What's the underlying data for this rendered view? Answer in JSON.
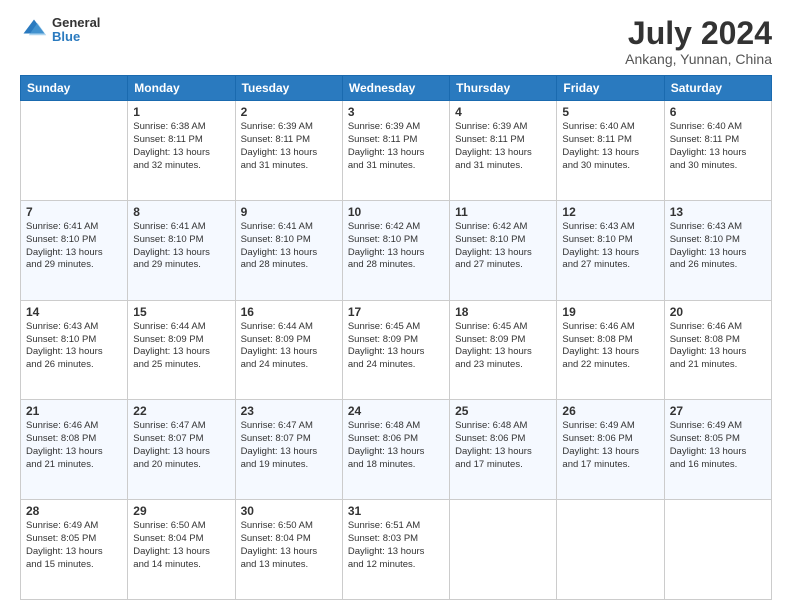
{
  "header": {
    "title": "July 2024",
    "subtitle": "Ankang, Yunnan, China",
    "logo_line1": "General",
    "logo_line2": "Blue"
  },
  "days_of_week": [
    "Sunday",
    "Monday",
    "Tuesday",
    "Wednesday",
    "Thursday",
    "Friday",
    "Saturday"
  ],
  "weeks": [
    [
      {
        "day": "",
        "info": ""
      },
      {
        "day": "1",
        "info": "Sunrise: 6:38 AM\nSunset: 8:11 PM\nDaylight: 13 hours\nand 32 minutes."
      },
      {
        "day": "2",
        "info": "Sunrise: 6:39 AM\nSunset: 8:11 PM\nDaylight: 13 hours\nand 31 minutes."
      },
      {
        "day": "3",
        "info": "Sunrise: 6:39 AM\nSunset: 8:11 PM\nDaylight: 13 hours\nand 31 minutes."
      },
      {
        "day": "4",
        "info": "Sunrise: 6:39 AM\nSunset: 8:11 PM\nDaylight: 13 hours\nand 31 minutes."
      },
      {
        "day": "5",
        "info": "Sunrise: 6:40 AM\nSunset: 8:11 PM\nDaylight: 13 hours\nand 30 minutes."
      },
      {
        "day": "6",
        "info": "Sunrise: 6:40 AM\nSunset: 8:11 PM\nDaylight: 13 hours\nand 30 minutes."
      }
    ],
    [
      {
        "day": "7",
        "info": "Sunrise: 6:41 AM\nSunset: 8:10 PM\nDaylight: 13 hours\nand 29 minutes."
      },
      {
        "day": "8",
        "info": "Sunrise: 6:41 AM\nSunset: 8:10 PM\nDaylight: 13 hours\nand 29 minutes."
      },
      {
        "day": "9",
        "info": "Sunrise: 6:41 AM\nSunset: 8:10 PM\nDaylight: 13 hours\nand 28 minutes."
      },
      {
        "day": "10",
        "info": "Sunrise: 6:42 AM\nSunset: 8:10 PM\nDaylight: 13 hours\nand 28 minutes."
      },
      {
        "day": "11",
        "info": "Sunrise: 6:42 AM\nSunset: 8:10 PM\nDaylight: 13 hours\nand 27 minutes."
      },
      {
        "day": "12",
        "info": "Sunrise: 6:43 AM\nSunset: 8:10 PM\nDaylight: 13 hours\nand 27 minutes."
      },
      {
        "day": "13",
        "info": "Sunrise: 6:43 AM\nSunset: 8:10 PM\nDaylight: 13 hours\nand 26 minutes."
      }
    ],
    [
      {
        "day": "14",
        "info": "Sunrise: 6:43 AM\nSunset: 8:10 PM\nDaylight: 13 hours\nand 26 minutes."
      },
      {
        "day": "15",
        "info": "Sunrise: 6:44 AM\nSunset: 8:09 PM\nDaylight: 13 hours\nand 25 minutes."
      },
      {
        "day": "16",
        "info": "Sunrise: 6:44 AM\nSunset: 8:09 PM\nDaylight: 13 hours\nand 24 minutes."
      },
      {
        "day": "17",
        "info": "Sunrise: 6:45 AM\nSunset: 8:09 PM\nDaylight: 13 hours\nand 24 minutes."
      },
      {
        "day": "18",
        "info": "Sunrise: 6:45 AM\nSunset: 8:09 PM\nDaylight: 13 hours\nand 23 minutes."
      },
      {
        "day": "19",
        "info": "Sunrise: 6:46 AM\nSunset: 8:08 PM\nDaylight: 13 hours\nand 22 minutes."
      },
      {
        "day": "20",
        "info": "Sunrise: 6:46 AM\nSunset: 8:08 PM\nDaylight: 13 hours\nand 21 minutes."
      }
    ],
    [
      {
        "day": "21",
        "info": "Sunrise: 6:46 AM\nSunset: 8:08 PM\nDaylight: 13 hours\nand 21 minutes."
      },
      {
        "day": "22",
        "info": "Sunrise: 6:47 AM\nSunset: 8:07 PM\nDaylight: 13 hours\nand 20 minutes."
      },
      {
        "day": "23",
        "info": "Sunrise: 6:47 AM\nSunset: 8:07 PM\nDaylight: 13 hours\nand 19 minutes."
      },
      {
        "day": "24",
        "info": "Sunrise: 6:48 AM\nSunset: 8:06 PM\nDaylight: 13 hours\nand 18 minutes."
      },
      {
        "day": "25",
        "info": "Sunrise: 6:48 AM\nSunset: 8:06 PM\nDaylight: 13 hours\nand 17 minutes."
      },
      {
        "day": "26",
        "info": "Sunrise: 6:49 AM\nSunset: 8:06 PM\nDaylight: 13 hours\nand 17 minutes."
      },
      {
        "day": "27",
        "info": "Sunrise: 6:49 AM\nSunset: 8:05 PM\nDaylight: 13 hours\nand 16 minutes."
      }
    ],
    [
      {
        "day": "28",
        "info": "Sunrise: 6:49 AM\nSunset: 8:05 PM\nDaylight: 13 hours\nand 15 minutes."
      },
      {
        "day": "29",
        "info": "Sunrise: 6:50 AM\nSunset: 8:04 PM\nDaylight: 13 hours\nand 14 minutes."
      },
      {
        "day": "30",
        "info": "Sunrise: 6:50 AM\nSunset: 8:04 PM\nDaylight: 13 hours\nand 13 minutes."
      },
      {
        "day": "31",
        "info": "Sunrise: 6:51 AM\nSunset: 8:03 PM\nDaylight: 13 hours\nand 12 minutes."
      },
      {
        "day": "",
        "info": ""
      },
      {
        "day": "",
        "info": ""
      },
      {
        "day": "",
        "info": ""
      }
    ]
  ]
}
